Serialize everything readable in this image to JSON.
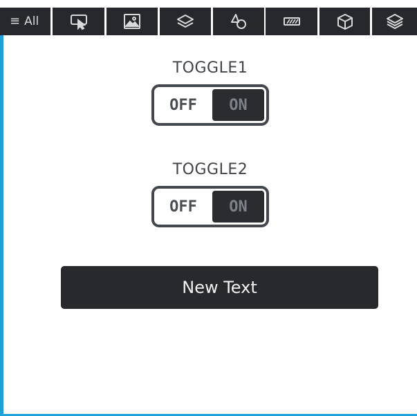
{
  "toolbar": {
    "all_label": "All",
    "buttons": [
      {
        "icon": "pointer-screen-icon"
      },
      {
        "icon": "image-icon"
      },
      {
        "icon": "layers-icon"
      },
      {
        "icon": "shapes-icon"
      },
      {
        "icon": "striped-bar-icon"
      },
      {
        "icon": "cube-icon"
      },
      {
        "icon": "layers-stack-icon"
      }
    ]
  },
  "toggles": [
    {
      "label": "TOGGLE1",
      "off_label": "OFF",
      "on_label": "ON",
      "state": "on"
    },
    {
      "label": "TOGGLE2",
      "off_label": "OFF",
      "on_label": "ON",
      "state": "on"
    }
  ],
  "button": {
    "label": "New Text"
  },
  "colors": {
    "accent": "#1ea0d8",
    "dark": "#26282c"
  }
}
